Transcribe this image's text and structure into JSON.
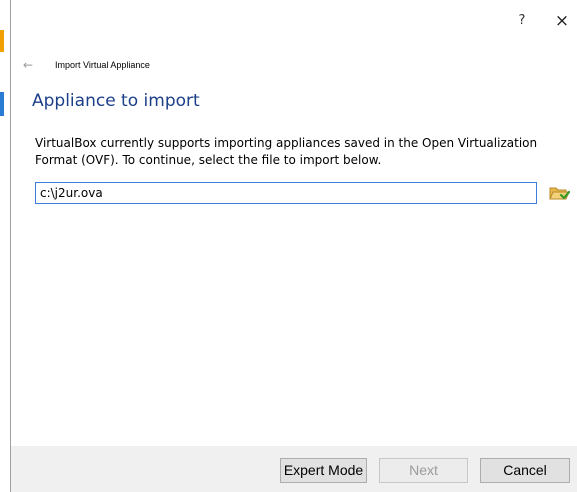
{
  "titlebar": {
    "help_label": "?",
    "close_label": "×"
  },
  "nav": {
    "back_icon": "←",
    "breadcrumb": "Import Virtual Appliance"
  },
  "page": {
    "heading": "Appliance to import",
    "description": "VirtualBox currently supports importing appliances saved in the Open Virtualization Format (OVF). To continue, select the file to import below."
  },
  "file": {
    "value": "c:\\j2ur.ova",
    "browse_icon": "folder-open-icon"
  },
  "buttons": {
    "expert_mode": "Expert Mode",
    "next": "Next",
    "cancel": "Cancel"
  },
  "colors": {
    "heading": "#1c3f8a",
    "input_border": "#3d7fd8",
    "footer_bg": "#f0f0f0"
  }
}
